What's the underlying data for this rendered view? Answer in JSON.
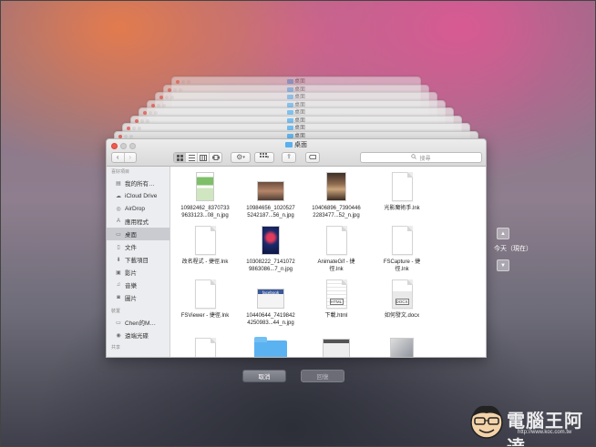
{
  "window": {
    "title": "桌面",
    "stack_title": "桌面",
    "search_placeholder": "搜尋"
  },
  "sidebar": {
    "favorites_header": "喜好項目",
    "devices_header": "裝置",
    "shared_header": "共享",
    "items": [
      {
        "label": "我的所有…",
        "icon": "all-files-icon"
      },
      {
        "label": "iCloud Drive",
        "icon": "cloud-icon"
      },
      {
        "label": "AirDrop",
        "icon": "airdrop-icon"
      },
      {
        "label": "應用程式",
        "icon": "applications-icon"
      },
      {
        "label": "桌面",
        "icon": "desktop-icon",
        "selected": true
      },
      {
        "label": "文件",
        "icon": "documents-icon"
      },
      {
        "label": "下載項目",
        "icon": "downloads-icon"
      },
      {
        "label": "影片",
        "icon": "movies-icon"
      },
      {
        "label": "音樂",
        "icon": "music-icon"
      },
      {
        "label": "圖片",
        "icon": "pictures-icon"
      }
    ],
    "devices": [
      {
        "label": "Chen的M…",
        "icon": "computer-icon"
      },
      {
        "label": "遠端光碟",
        "icon": "disc-icon"
      }
    ]
  },
  "files": [
    {
      "label": "10982462_8370733\n9633123...08_n.jpg",
      "type": "photo-green"
    },
    {
      "label": "10984656_1020527\n5242187...56_n.jpg",
      "type": "photo-wide"
    },
    {
      "label": "10406896_7390446\n2283477...52_n.jpg",
      "type": "photo-food"
    },
    {
      "label": "光影魔術手.lnk",
      "type": "doc"
    },
    {
      "label": "改名程式 - 捷徑.lnk",
      "type": "doc"
    },
    {
      "label": "10308222_7141072\n9863086...7_n.jpg",
      "type": "photo-blue"
    },
    {
      "label": "AnimateGif - 捷\n徑.lnk",
      "type": "doc"
    },
    {
      "label": "FSCapture - 捷\n徑.lnk",
      "type": "doc"
    },
    {
      "label": "FSViewer - 捷徑.lnk",
      "type": "doc"
    },
    {
      "label": "10440644_7419842\n4250983...44_n.jpg",
      "type": "photo-facebook"
    },
    {
      "label": "下載.html",
      "type": "html"
    },
    {
      "label": "如何發文.docx",
      "type": "docx"
    }
  ],
  "file_tags": {
    "html": "HTML",
    "docx": "DOCX",
    "facebook": "facebook"
  },
  "buttons": {
    "cancel": "取消",
    "restore": "回復"
  },
  "timeline": {
    "label": "今天（現在）"
  },
  "watermark": {
    "text": "電腦王阿達",
    "url": "http://www.koc.com.tw"
  },
  "colors": {
    "folder_blue": "#5bb2f1",
    "close_red": "#ef5b4f",
    "sidebar_bg": "#ecedf0",
    "selected_row": "#c9cbd1"
  }
}
